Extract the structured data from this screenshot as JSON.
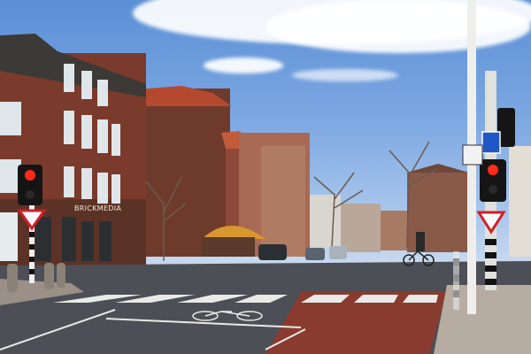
{
  "scene": {
    "shop_sign": "BRICKMEDIA",
    "colors": {
      "sky": "#7ea9e2",
      "brick": "#7a3a2c",
      "road": "#4c4f55",
      "bike_lane": "#8a3b2f",
      "signal_red": "#ff2a18",
      "yield_sign_red": "#d21f26",
      "info_sign_blue": "#1f57c7"
    },
    "icons": [
      "traffic-light-icon",
      "yield-sign-icon",
      "bicycle-icon",
      "info-sign-icon",
      "speed-limit-sign-icon"
    ]
  }
}
